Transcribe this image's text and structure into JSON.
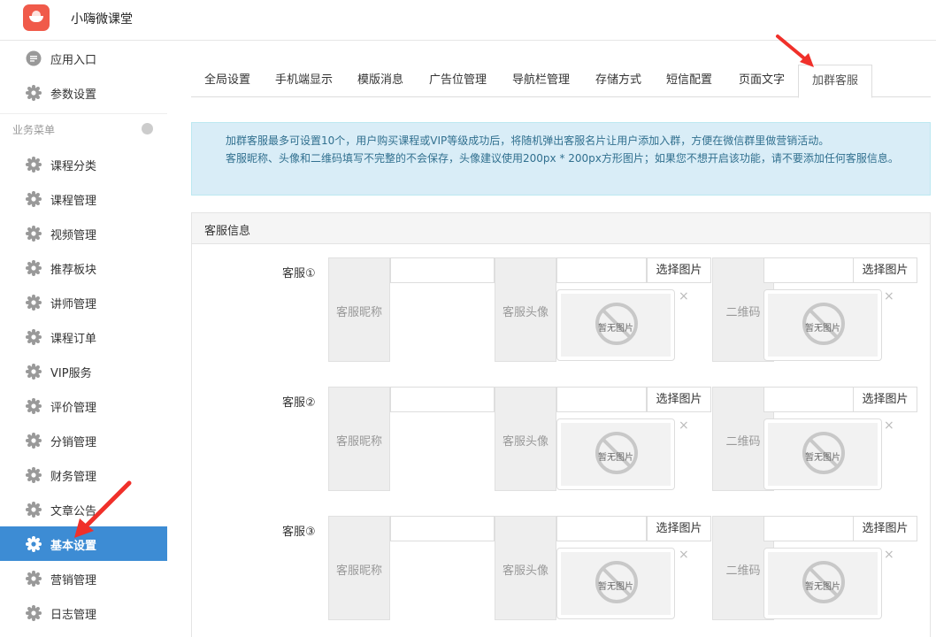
{
  "header": {
    "app_title": "小嗨微课堂",
    "logo_icon": "chef-hat-icon"
  },
  "sidebar": {
    "top_items": [
      {
        "label": "应用入口",
        "icon": "chat-bubble-icon"
      },
      {
        "label": "参数设置",
        "icon": "gear-icon"
      }
    ],
    "section_label": "业务菜单",
    "items": [
      {
        "label": "课程分类"
      },
      {
        "label": "课程管理"
      },
      {
        "label": "视频管理"
      },
      {
        "label": "推荐板块"
      },
      {
        "label": "讲师管理"
      },
      {
        "label": "课程订单"
      },
      {
        "label": "VIP服务"
      },
      {
        "label": "评价管理"
      },
      {
        "label": "分销管理"
      },
      {
        "label": "财务管理"
      },
      {
        "label": "文章公告"
      },
      {
        "label": "基本设置"
      },
      {
        "label": "营销管理"
      },
      {
        "label": "日志管理"
      }
    ],
    "active_label": "基本设置",
    "accent_color": "#3d8cd4"
  },
  "tabs": [
    {
      "label": "全局设置"
    },
    {
      "label": "手机端显示"
    },
    {
      "label": "模版消息"
    },
    {
      "label": "广告位管理"
    },
    {
      "label": "导航栏管理"
    },
    {
      "label": "存储方式"
    },
    {
      "label": "短信配置"
    },
    {
      "label": "页面文字"
    },
    {
      "label": "加群客服"
    }
  ],
  "active_tab": "加群客服",
  "notice": {
    "line1": "加群客服最多可设置10个，用户购买课程或VIP等级成功后，将随机弹出客服名片让用户添加入群，方便在微信群里做营销活动。",
    "line2": "客服昵称、头像和二维码填写不完整的不会保存，头像建议使用200px * 200px方形图片；如果您不想开启该功能，请不要添加任何客服信息。"
  },
  "panel": {
    "title": "客服信息",
    "nickname_label": "客服昵称",
    "avatar_label": "客服头像",
    "qrcode_label": "二维码",
    "pick_button": "选择图片",
    "no_image_text": "暂无图片",
    "close_mark": "×",
    "rows": [
      {
        "label": "客服①",
        "nickname": "",
        "avatar": "",
        "qrcode": ""
      },
      {
        "label": "客服②",
        "nickname": "",
        "avatar": "",
        "qrcode": ""
      },
      {
        "label": "客服③",
        "nickname": "",
        "avatar": "",
        "qrcode": ""
      }
    ]
  }
}
